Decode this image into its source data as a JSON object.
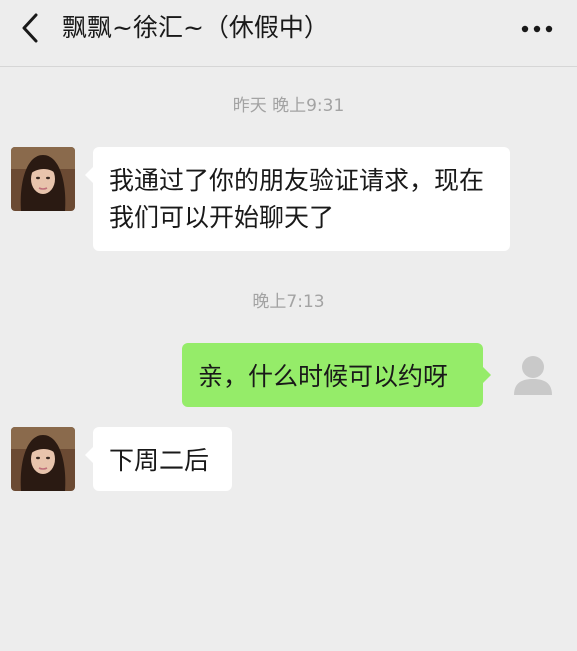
{
  "header": {
    "back_icon": "chevron-left-icon",
    "title": "飘飘~徐汇~（休假中）",
    "more_icon": "more-horizontal-icon"
  },
  "messages": [
    {
      "type": "time",
      "text": "昨天 晚上9:31"
    },
    {
      "type": "incoming",
      "text": "我通过了你的朋友验证请求，现在我们可以开始聊天了",
      "avatar": "contact-photo-avatar"
    },
    {
      "type": "time",
      "text": "晚上7:13"
    },
    {
      "type": "outgoing",
      "text": "亲，什么时候可以约呀",
      "avatar": "default-user-avatar"
    },
    {
      "type": "incoming",
      "text": "下周二后",
      "avatar": "contact-photo-avatar"
    }
  ],
  "colors": {
    "background": "#ededed",
    "incoming_bubble": "#ffffff",
    "outgoing_bubble": "#95ec69",
    "timestamp": "#a3a3a3"
  }
}
